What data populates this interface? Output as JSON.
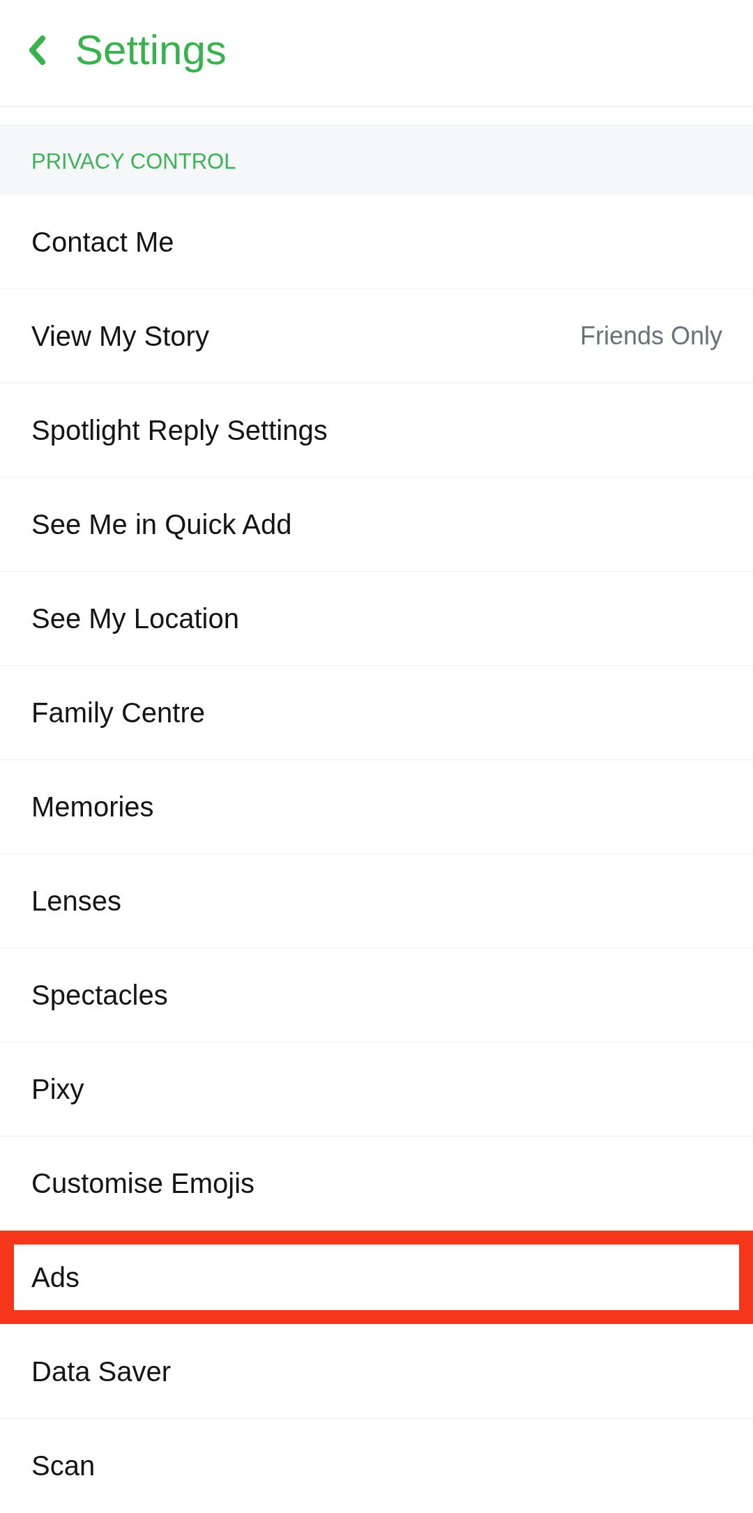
{
  "header": {
    "title": "Settings"
  },
  "section": {
    "title": "PRIVACY CONTROL"
  },
  "rows": [
    {
      "label": "Contact Me",
      "highlighted": false
    },
    {
      "label": "View My Story",
      "value": "Friends Only",
      "highlighted": false
    },
    {
      "label": "Spotlight Reply Settings",
      "highlighted": false
    },
    {
      "label": "See Me in Quick Add",
      "highlighted": false
    },
    {
      "label": "See My Location",
      "highlighted": false
    },
    {
      "label": "Family Centre",
      "highlighted": false
    },
    {
      "label": "Memories",
      "highlighted": false
    },
    {
      "label": "Lenses",
      "highlighted": false
    },
    {
      "label": "Spectacles",
      "highlighted": false
    },
    {
      "label": "Pixy",
      "highlighted": false
    },
    {
      "label": "Customise Emojis",
      "highlighted": false
    },
    {
      "label": "Ads",
      "highlighted": true
    },
    {
      "label": "Data Saver",
      "highlighted": false
    },
    {
      "label": "Scan",
      "highlighted": false
    }
  ]
}
